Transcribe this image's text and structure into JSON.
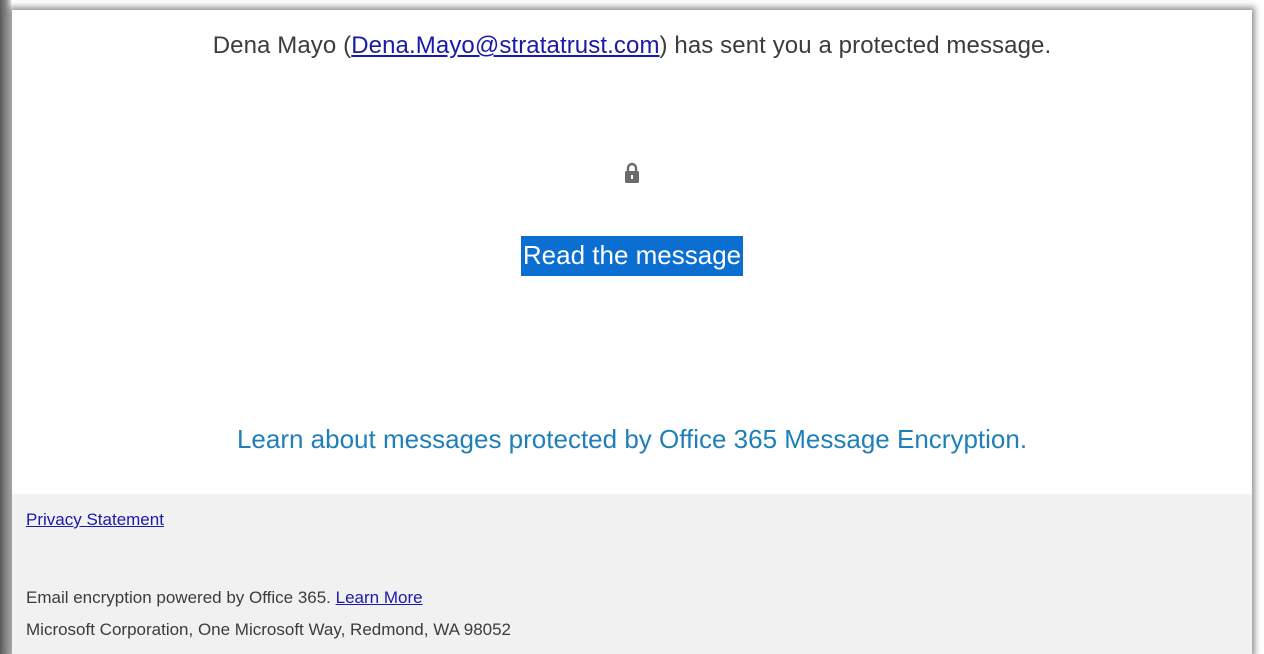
{
  "message": {
    "sender_name": "Dena Mayo",
    "open_paren": "(",
    "sender_email": "Dena.Mayo@stratatrust.com",
    "sent_text": ") has sent you a protected message.",
    "lock_icon": "lock-icon",
    "read_button_label": "Read the message",
    "learn_text": "Learn about messages protected by Office 365 Message Encryption."
  },
  "footer": {
    "privacy_label": "Privacy Statement",
    "powered_text": "Email encryption powered by Office 365.",
    "learn_more_label": "Learn More",
    "address": "Microsoft Corporation, One Microsoft Way, Redmond, WA 98052"
  },
  "colors": {
    "link": "#1a1aa8",
    "button_bg": "#0a6fd0",
    "learn_text": "#1f7fb9",
    "footer_bg": "#f1f1f1"
  }
}
